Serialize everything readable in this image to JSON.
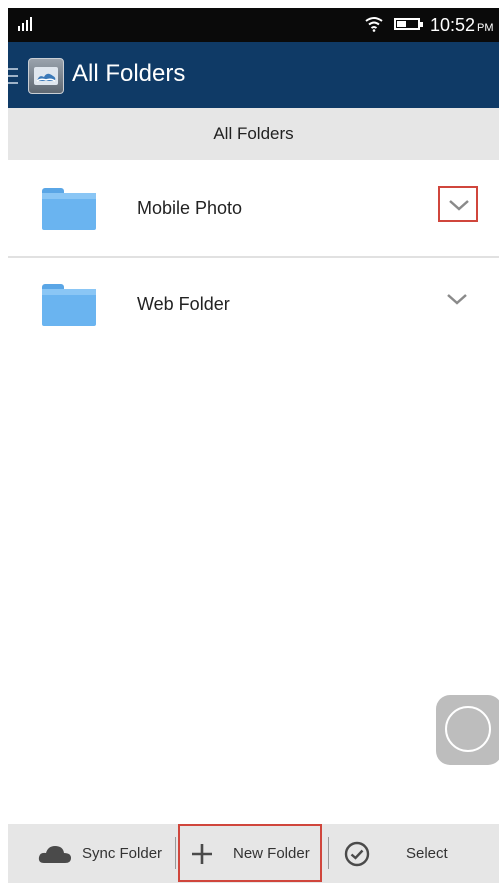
{
  "status_bar": {
    "time": "10:52",
    "ampm": "PM",
    "icons": [
      "signal-icon",
      "wifi-icon",
      "battery-icon"
    ]
  },
  "app_bar": {
    "title": "All Folders",
    "icons": [
      "menu-icon",
      "app-logo-icon"
    ]
  },
  "section_header": {
    "title": "All Folders"
  },
  "folders": [
    {
      "name": "Mobile Photo",
      "icon": "folder-icon",
      "action_icon": "chevron-down-icon"
    },
    {
      "name": "Web Folder",
      "icon": "folder-icon",
      "action_icon": "chevron-down-icon"
    }
  ],
  "toolbar": {
    "sync_label": "Sync Folder",
    "new_label": "New Folder",
    "select_label": "Select",
    "icons": [
      "cloud-icon",
      "plus-icon",
      "check-circle-icon"
    ]
  },
  "colors": {
    "app_bar": "#0f3a66",
    "folder": "#6ab4f0",
    "highlight": "#d0463c",
    "bars": "#e6e6e6"
  }
}
